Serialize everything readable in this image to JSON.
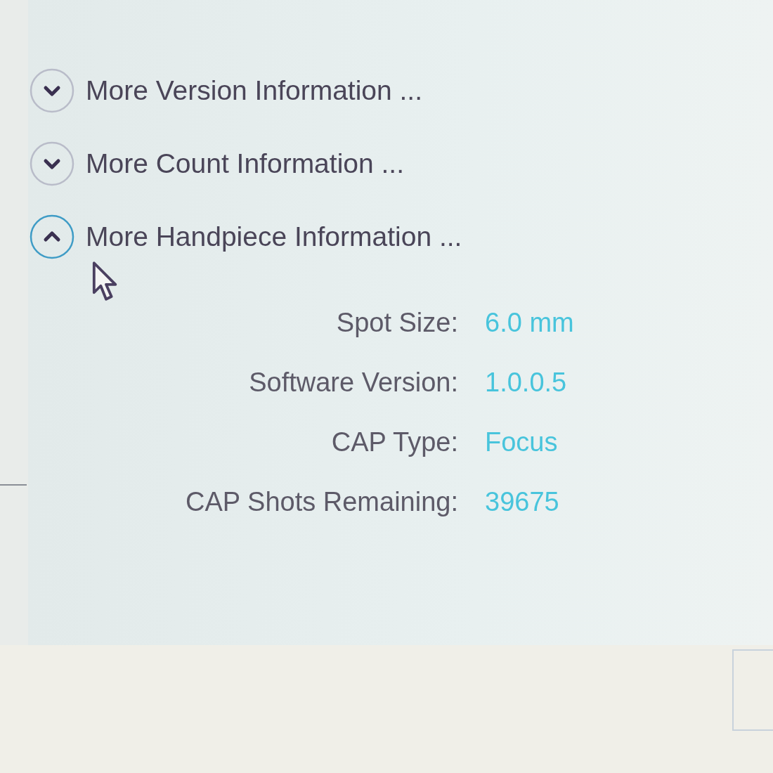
{
  "sections": [
    {
      "label": "More Version Information ...",
      "expanded": false
    },
    {
      "label": "More Count Information ...",
      "expanded": false
    },
    {
      "label": "More Handpiece Information ...",
      "expanded": true,
      "details": [
        {
          "label": "Spot Size:",
          "value": "6.0 mm"
        },
        {
          "label": "Software Version:",
          "value": "1.0.0.5"
        },
        {
          "label": "CAP Type:",
          "value": "Focus"
        },
        {
          "label": "CAP Shots Remaining:",
          "value": "39675"
        }
      ]
    }
  ]
}
